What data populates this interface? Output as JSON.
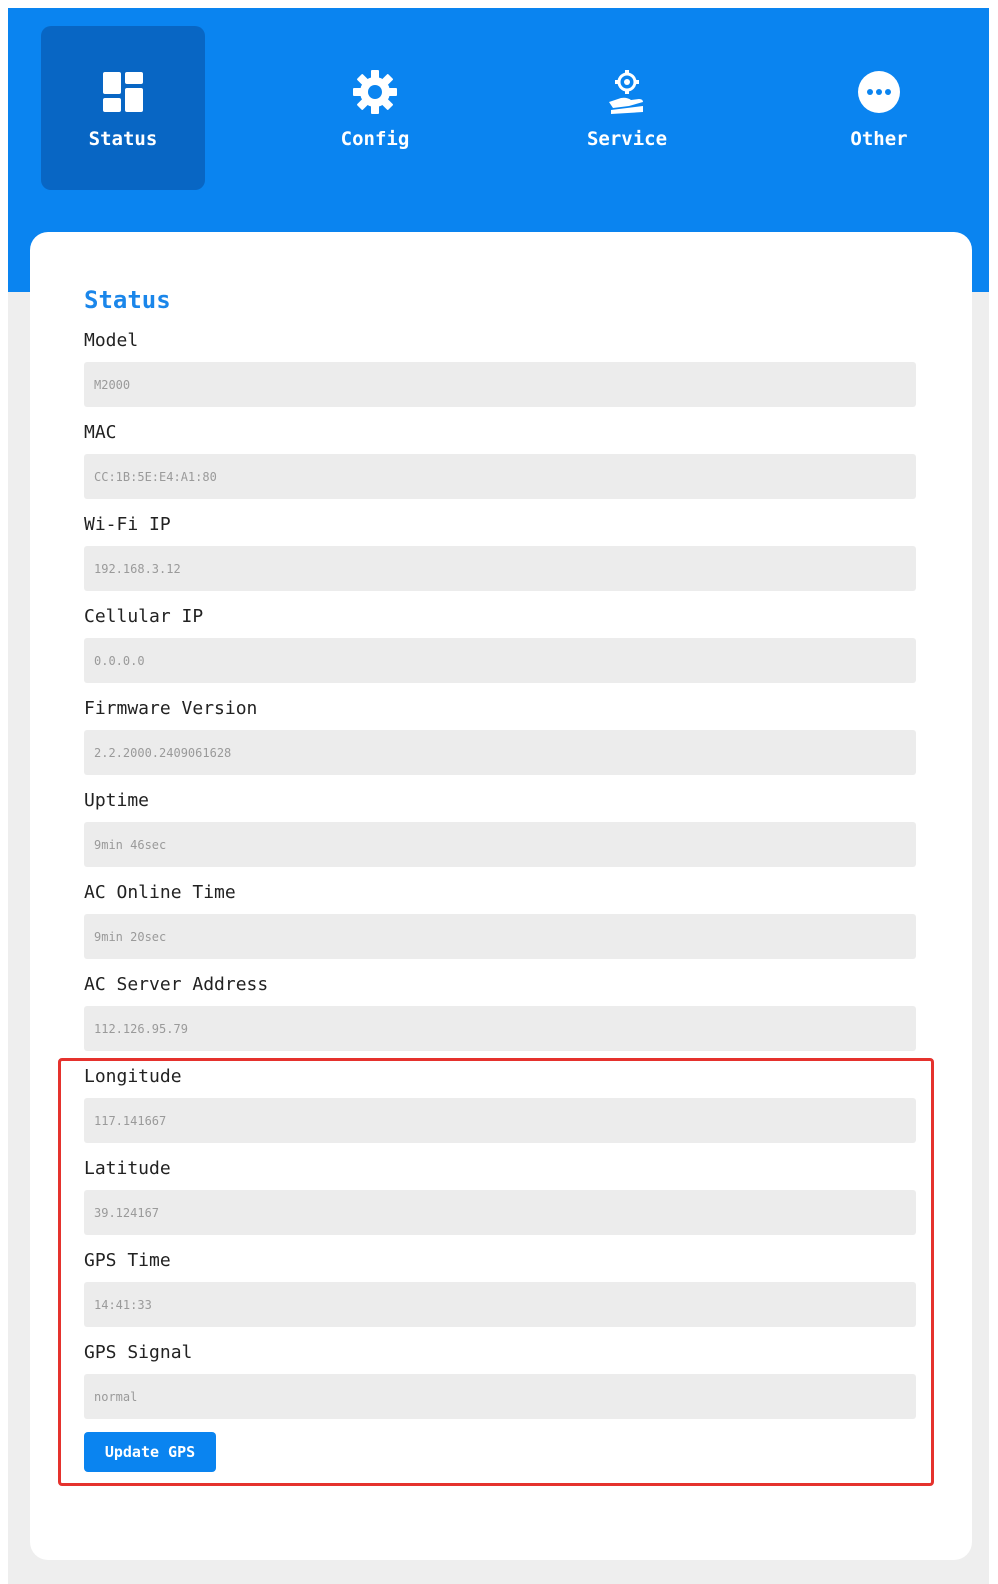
{
  "nav": {
    "items": [
      {
        "label": "Status",
        "icon": "dashboard-icon",
        "active": true
      },
      {
        "label": "Config",
        "icon": "gear-icon",
        "active": false
      },
      {
        "label": "Service",
        "icon": "service-hand-gear-icon",
        "active": false
      },
      {
        "label": "Other",
        "icon": "more-dots-icon",
        "active": false
      }
    ]
  },
  "status": {
    "title": "Status",
    "fields": [
      {
        "label": "Model",
        "value": "M2000"
      },
      {
        "label": "MAC",
        "value": "CC:1B:5E:E4:A1:80"
      },
      {
        "label": "Wi-Fi IP",
        "value": "192.168.3.12"
      },
      {
        "label": "Cellular IP",
        "value": "0.0.0.0"
      },
      {
        "label": "Firmware Version",
        "value": "2.2.2000.2409061628"
      },
      {
        "label": "Uptime",
        "value": "9min 46sec"
      },
      {
        "label": "AC Online Time",
        "value": "9min 20sec"
      },
      {
        "label": "AC Server Address",
        "value": "112.126.95.79"
      },
      {
        "label": "Longitude",
        "value": "117.141667"
      },
      {
        "label": "Latitude",
        "value": "39.124167"
      },
      {
        "label": "GPS Time",
        "value": "14:41:33"
      },
      {
        "label": "GPS Signal",
        "value": "normal"
      }
    ],
    "update_gps_label": "Update GPS"
  },
  "colors": {
    "brand_blue": "#0a84f0",
    "active_tab": "#0866c4",
    "title_blue": "#1a86ea",
    "highlight_red": "#e5322d"
  }
}
